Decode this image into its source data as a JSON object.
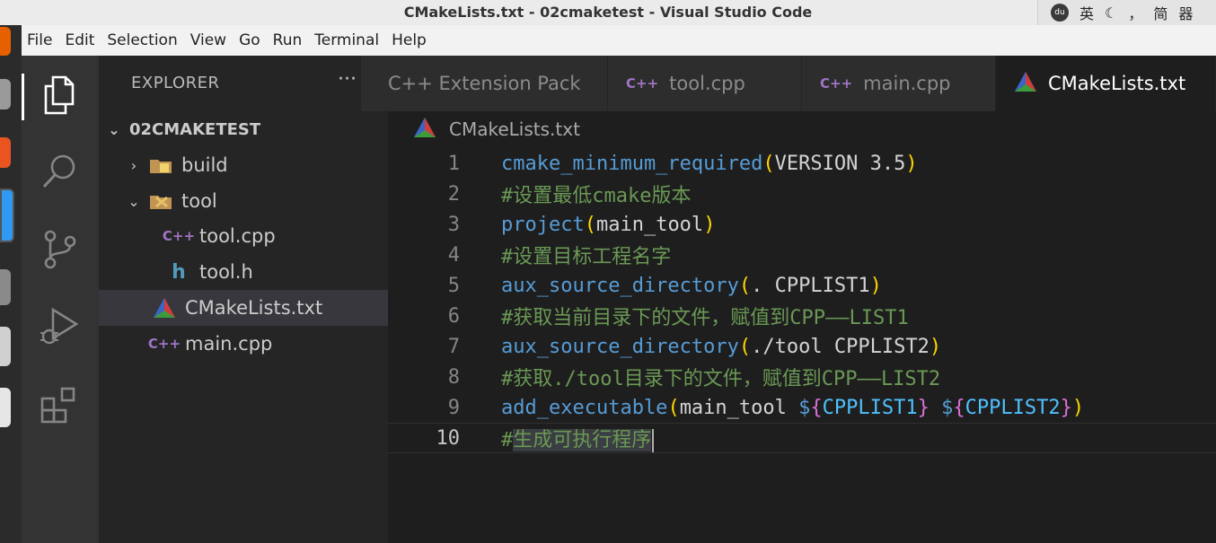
{
  "window": {
    "title": "CMakeLists.txt - 02cmaketest - Visual Studio Code"
  },
  "tray": {
    "ime_lang": "英",
    "punct": "，",
    "script": "简",
    "grid_label": "器"
  },
  "menu": [
    "File",
    "Edit",
    "Selection",
    "View",
    "Go",
    "Run",
    "Terminal",
    "Help"
  ],
  "explorer": {
    "title": "EXPLORER",
    "more": "···",
    "root": "02CMAKETEST",
    "items": [
      {
        "label": "build"
      },
      {
        "label": "tool"
      },
      {
        "label": "tool.cpp"
      },
      {
        "label": "tool.h"
      },
      {
        "label": "CMakeLists.txt"
      },
      {
        "label": "main.cpp"
      }
    ]
  },
  "tabs": [
    {
      "label": "C++ Extension Pack"
    },
    {
      "label": "tool.cpp"
    },
    {
      "label": "main.cpp"
    },
    {
      "label": "CMakeLists.txt"
    }
  ],
  "breadcrumb": "CMakeLists.txt",
  "code": {
    "line_numbers": [
      "1",
      "2",
      "3",
      "4",
      "5",
      "6",
      "7",
      "8",
      "9",
      "10"
    ],
    "l1": {
      "fn": "cmake_minimum_required",
      "open": "(",
      "arg": "VERSION 3.5",
      "close": ")"
    },
    "l2": "#设置最低cmake版本",
    "l3": {
      "fn": "project",
      "open": "(",
      "arg": "main_tool",
      "close": ")"
    },
    "l4": "#设置目标工程名字",
    "l5": {
      "fn": "aux_source_directory",
      "open": "(",
      "arg": ". CPPLIST1",
      "close": ")"
    },
    "l6": "#获取当前目录下的文件，赋值到CPP——LIST1",
    "l7": {
      "fn": "aux_source_directory",
      "open": "(",
      "arg": "./tool CPPLIST2",
      "close": ")"
    },
    "l8": "#获取./tool目录下的文件，赋值到CPP——LIST2",
    "l9": {
      "fn": "add_executable",
      "open": "(",
      "arg": "main_tool ",
      "d1": "$",
      "b1o": "{",
      "v1": "CPPLIST1",
      "b1c": "}",
      "sp": " ",
      "d2": "$",
      "b2o": "{",
      "v2": "CPPLIST2",
      "b2c": "}",
      "close": ")"
    },
    "l10_hash": "#",
    "l10_text": "生成可执行程序"
  }
}
